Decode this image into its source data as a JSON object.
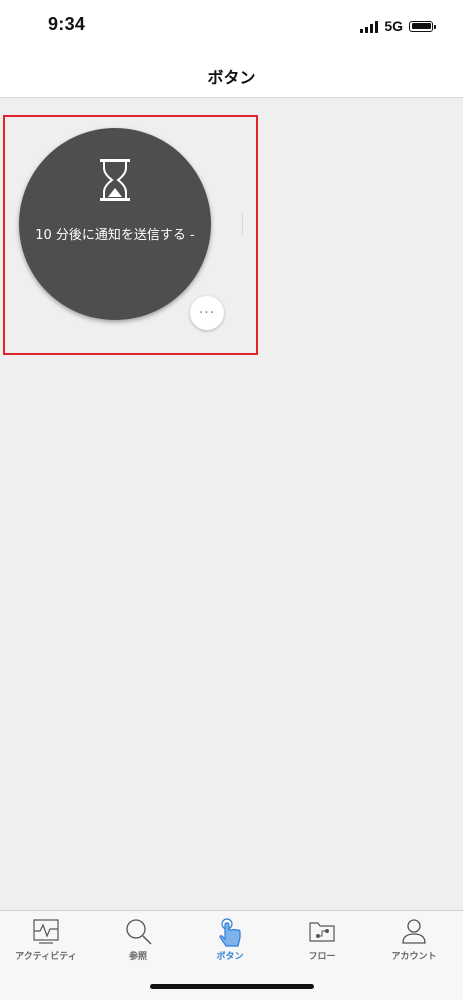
{
  "status_bar": {
    "time": "9:34",
    "network": "5G"
  },
  "nav": {
    "title": "ボタン"
  },
  "flow_button": {
    "label": "10 分後に通知を送信する -",
    "more_label": "···"
  },
  "tabs": [
    {
      "label": "アクティビティ",
      "icon": "activity-icon"
    },
    {
      "label": "参照",
      "icon": "search-icon"
    },
    {
      "label": "ボタン",
      "icon": "tap-hand-icon",
      "active": true
    },
    {
      "label": "フロー",
      "icon": "flow-folder-icon"
    },
    {
      "label": "アカウント",
      "icon": "account-icon"
    }
  ],
  "colors": {
    "highlight": "#e0232b",
    "button_bg": "#4e4e4d",
    "active_tab": "#2f7fd6",
    "background": "#efefef"
  }
}
